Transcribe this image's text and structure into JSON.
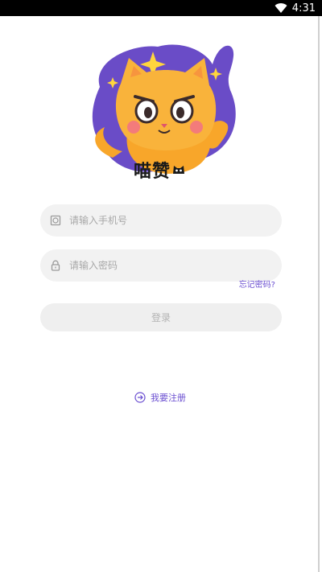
{
  "status_bar": {
    "time": "4:31",
    "wifi_icon": "wifi-icon"
  },
  "app": {
    "brand_name": "喵赞"
  },
  "form": {
    "phone_placeholder": "请输入手机号",
    "password_placeholder": "请输入密码",
    "forgot_label": "忘记密码?",
    "login_label": "登录"
  },
  "footer": {
    "register_label": "我要注册"
  },
  "colors": {
    "accent": "#6b4fd1",
    "cat_orange": "#f8a62a",
    "blob_purple": "#6a4cc7"
  }
}
